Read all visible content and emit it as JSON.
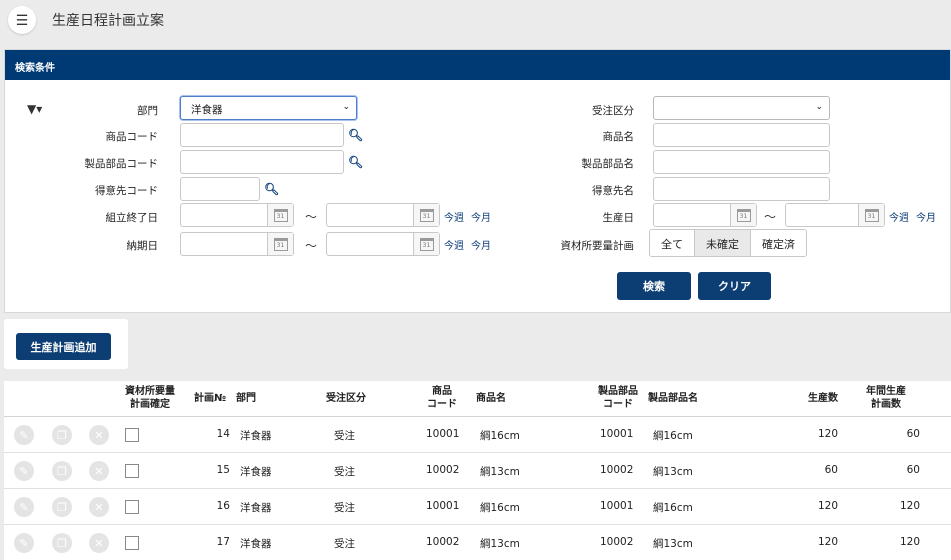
{
  "header": {
    "menu_icon": "☰",
    "title": "生産日程計画立案"
  },
  "search": {
    "panel_title": "検索条件",
    "filter_icon": "▼▾",
    "dept_label": "部門",
    "dept_value": "洋食器",
    "order_type_label": "受注区分",
    "order_type_value": "",
    "product_code_label": "商品コード",
    "product_name_label": "商品名",
    "part_code_label": "製品部品コード",
    "part_name_label": "製品部品名",
    "customer_code_label": "得意先コード",
    "customer_name_label": "得意先名",
    "assembly_end_label": "組立終了日",
    "production_date_label": "生産日",
    "due_date_label": "納期日",
    "material_plan_label": "資材所要量計画",
    "tilde": "～",
    "this_week": "今週",
    "this_month": "今月",
    "cal_day": "31",
    "search_glyph": "🔍︎",
    "seg_options": [
      "全て",
      "未確定",
      "確定済"
    ],
    "search_button": "検索",
    "clear_button": "クリア"
  },
  "add_button": "生産計画追加",
  "table": {
    "headers": {
      "material_confirm_1": "資材所要量",
      "material_confirm_2": "計画確定",
      "plan_no": "計画№",
      "dept": "部門",
      "order_type": "受注区分",
      "product_code_1": "商品",
      "product_code_2": "コード",
      "product_name": "商品名",
      "part_code_1": "製品部品",
      "part_code_2": "コード",
      "part_name": "製品部品名",
      "production_qty": "生産数",
      "annual_1": "年間生産",
      "annual_2": "計画数"
    },
    "rows": [
      {
        "plan_no": "14",
        "dept": "洋食器",
        "order_type": "受注",
        "product_code": "10001",
        "product_name": "綱16cm",
        "part_code": "10001",
        "part_name": "綱16cm",
        "production_qty": "120",
        "annual": "60"
      },
      {
        "plan_no": "15",
        "dept": "洋食器",
        "order_type": "受注",
        "product_code": "10002",
        "product_name": "綱13cm",
        "part_code": "10002",
        "part_name": "綱13cm",
        "production_qty": "60",
        "annual": "60"
      },
      {
        "plan_no": "16",
        "dept": "洋食器",
        "order_type": "受注",
        "product_code": "10001",
        "product_name": "綱16cm",
        "part_code": "10001",
        "part_name": "綱16cm",
        "production_qty": "120",
        "annual": "120"
      },
      {
        "plan_no": "17",
        "dept": "洋食器",
        "order_type": "受注",
        "product_code": "10002",
        "product_name": "綱13cm",
        "part_code": "10002",
        "part_name": "綱13cm",
        "production_qty": "120",
        "annual": "120"
      }
    ],
    "row_icons": {
      "edit": "✎",
      "copy": "❐",
      "delete": "✕"
    }
  }
}
